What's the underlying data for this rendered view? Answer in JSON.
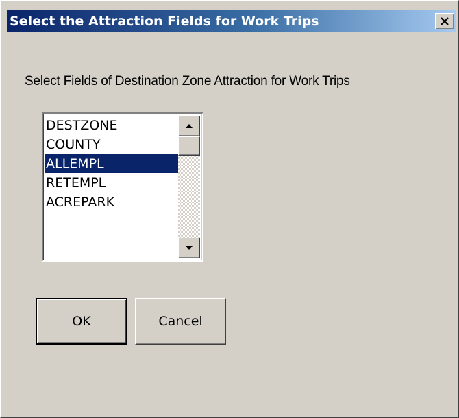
{
  "window": {
    "title": "Select the Attraction Fields for Work Trips",
    "titlebar_color": "#0a246a",
    "close_icon": "close-icon"
  },
  "prompt": "Select Fields of Destination Zone Attraction for Work Trips",
  "listbox": {
    "items": [
      {
        "label": "DESTZONE",
        "selected": false
      },
      {
        "label": "COUNTY",
        "selected": false
      },
      {
        "label": "ALLEMPL",
        "selected": true
      },
      {
        "label": "RETEMPL",
        "selected": false
      },
      {
        "label": "ACREPARK",
        "selected": false
      }
    ],
    "selection_color": "#0a246a",
    "scrollbar": {
      "up_icon": "scroll-up-arrow-icon",
      "down_icon": "scroll-down-arrow-icon"
    }
  },
  "buttons": {
    "ok_label": "OK",
    "cancel_label": "Cancel"
  },
  "colors": {
    "dialog_background": "#d4d0c8"
  }
}
